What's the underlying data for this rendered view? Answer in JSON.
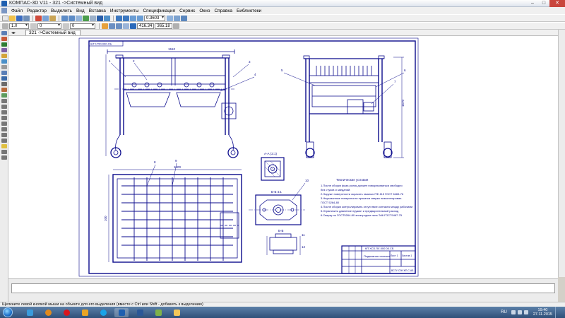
{
  "window": {
    "title": "КОМПАС-3D V11 - 321 ->Системный вид",
    "min_icon": "minimize-icon",
    "max_icon": "maximize-icon",
    "close_icon": "close-icon"
  },
  "menu": {
    "items": [
      "Файл",
      "Редактор",
      "Выделить",
      "Вид",
      "Вставка",
      "Инструменты",
      "Спецификация",
      "Сервис",
      "Окно",
      "Справка",
      "Библиотеки"
    ]
  },
  "toolbar1": {
    "zoom_value": "0.3603"
  },
  "toolbar2": {
    "line_scale": "1.0",
    "layer_value": "0",
    "view_value": "0",
    "coord_x": "416.34",
    "coord_y": "365.18"
  },
  "document": {
    "tab_label": "321 ->Системный вид"
  },
  "drawing": {
    "corner_stamp": "ШТ.1750.000.СБ",
    "dims": {
      "top_width": "1510",
      "height_right": "1570",
      "plan_width": "1500",
      "small_dim": "100"
    },
    "section_labels": {
      "sec1": "А-А (2:1)",
      "sec2": "Б-Б 4:1",
      "sec3": "Б-Б"
    },
    "tech_title": "Технические условия",
    "tech_lines": [
      "1.После сборки фаза ролик должен поворачиваться свободно",
      "без стуков и заеданий.",
      "2.Наружн поверхности окрасить  эмалью  ПФ-115 ГОСТ 6465-76",
      "3.Неуказанные поверхности прокатка сварка низколегирован.",
      "ГОСТ 5264-80",
      "4.После сборки контролировать отсутствие контакта между рабочими",
      "5.Ограничить давление пружин и предварительный расход",
      "6.Сварку по ГОСТ5264-80 электродом типа Э46 ГОСТ9467-75"
    ],
    "title_block": {
      "name": "КП.ХСХ.ЛХ.000.00.СБ",
      "product": "Подвижная тележка",
      "sheet": "Лист 1",
      "sheets": "Листов 1",
      "org": "ВСГУ ОЭУ.КП.С.АБ"
    },
    "callouts": [
      "1",
      "2",
      "3",
      "4",
      "5",
      "6",
      "7",
      "8",
      "9",
      "10",
      "11",
      "12"
    ]
  },
  "status": {
    "hint": "Щелкните левой кнопкой мыши на объекте для его выделения (вместе с Ctrl или Shift - добавить к выделению)"
  },
  "taskbar": {
    "lang": "RU",
    "time": "19:40",
    "date": "27.11.2015",
    "apps": [
      "explorer-icon",
      "media-player-icon",
      "opera-icon",
      "outlook-icon",
      "skype-icon",
      "kompas-icon",
      "word-icon",
      "paint-icon",
      "folder-icon"
    ]
  },
  "colors": {
    "drawing_line": "#0a0a8c",
    "sheet_bg": "#ffffff",
    "workspace_bg": "#d4d0c8"
  }
}
